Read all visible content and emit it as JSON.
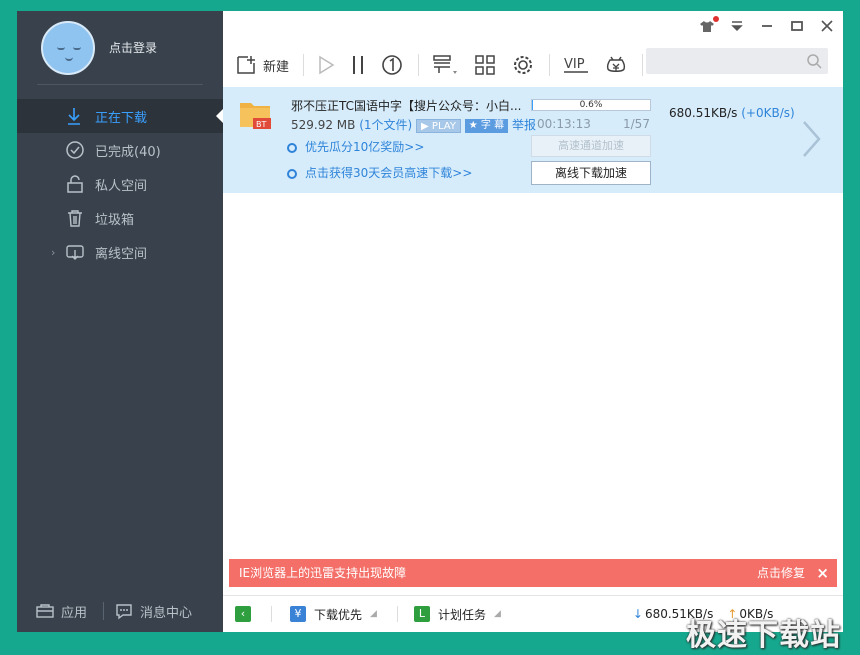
{
  "sidebar": {
    "login_label": "点击登录",
    "nav": [
      {
        "label": "正在下载",
        "icon": "download-arrow-icon",
        "active": true
      },
      {
        "label": "已完成(40)",
        "icon": "check-circle-icon"
      },
      {
        "label": "私人空间",
        "icon": "lock-icon"
      },
      {
        "label": "垃圾箱",
        "icon": "trash-icon"
      },
      {
        "label": "离线空间",
        "icon": "cloud-download-icon"
      }
    ],
    "bottom": {
      "apps_label": "应用",
      "messages_label": "消息中心"
    }
  },
  "toolbar": {
    "new_label": "新建"
  },
  "task": {
    "name": "邪不压正TC国语中字【搜片公众号：小白...",
    "size": "529.92 MB",
    "files": "(1个文件)",
    "play_badge": "PLAY",
    "subtitle_badge": "字 幕",
    "report": "举报",
    "progress_text": "0.6%",
    "progress_fraction": 0.006,
    "eta": "00:13:13",
    "pieces": "1/57",
    "speed": "680.51KB/s",
    "speed_plus": "(+0KB/s)",
    "promo1": "优先瓜分10亿奖励>>",
    "promo2": "点击获得30天会员高速下载>>",
    "btn_high_speed": "高速通道加速",
    "btn_offline": "离线下载加速"
  },
  "alert": {
    "text": "IE浏览器上的迅雷支持出现故障",
    "fix": "点击修复"
  },
  "statusbar": {
    "priority": "下载优先",
    "schedule": "计划任务",
    "down_speed": "680.51KB/s",
    "up_speed": "0KB/s"
  },
  "watermark": "极速下载站",
  "colors": {
    "accent": "#3aa0ff",
    "sidebar": "#39424c",
    "alert": "#f36f68",
    "task_bg": "#d6ecfb",
    "frame": "#16a88e"
  }
}
